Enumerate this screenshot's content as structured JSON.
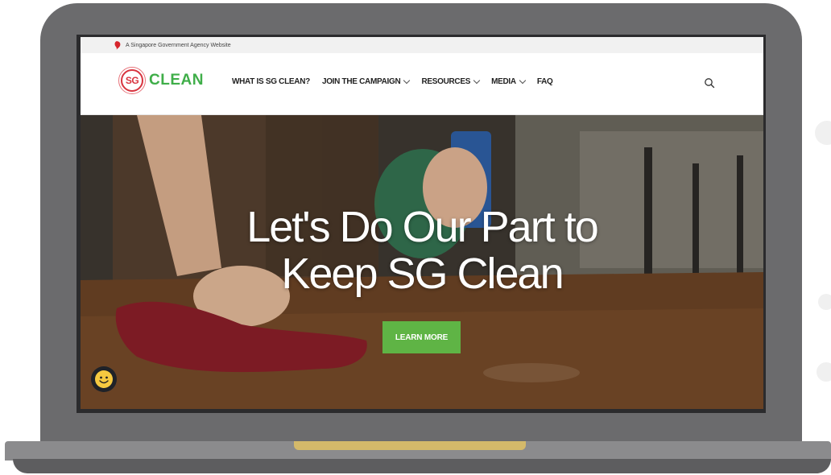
{
  "gov_bar": {
    "text": "A Singapore Government Agency Website",
    "icon": "lion-head-icon"
  },
  "logo": {
    "mark": "SG",
    "text": "CLEAN"
  },
  "nav": {
    "items": [
      {
        "label": "WHAT IS SG CLEAN?",
        "has_dropdown": false
      },
      {
        "label": "JOIN THE CAMPAIGN",
        "has_dropdown": true
      },
      {
        "label": "RESOURCES",
        "has_dropdown": true
      },
      {
        "label": "MEDIA",
        "has_dropdown": true
      },
      {
        "label": "FAQ",
        "has_dropdown": false
      }
    ],
    "search_icon": "search-icon"
  },
  "hero": {
    "title_line1": "Let's Do Our Part to",
    "title_line2": "Keep SG Clean",
    "button_label": "LEARN MORE"
  },
  "feedback": {
    "icon": "smiley-icon"
  },
  "colors": {
    "brand_red": "#d8343f",
    "brand_green": "#3fae49",
    "button_green": "#5fb445",
    "laptop_body": "#6b6b6d",
    "laptop_hinge": "#d4b96a"
  }
}
